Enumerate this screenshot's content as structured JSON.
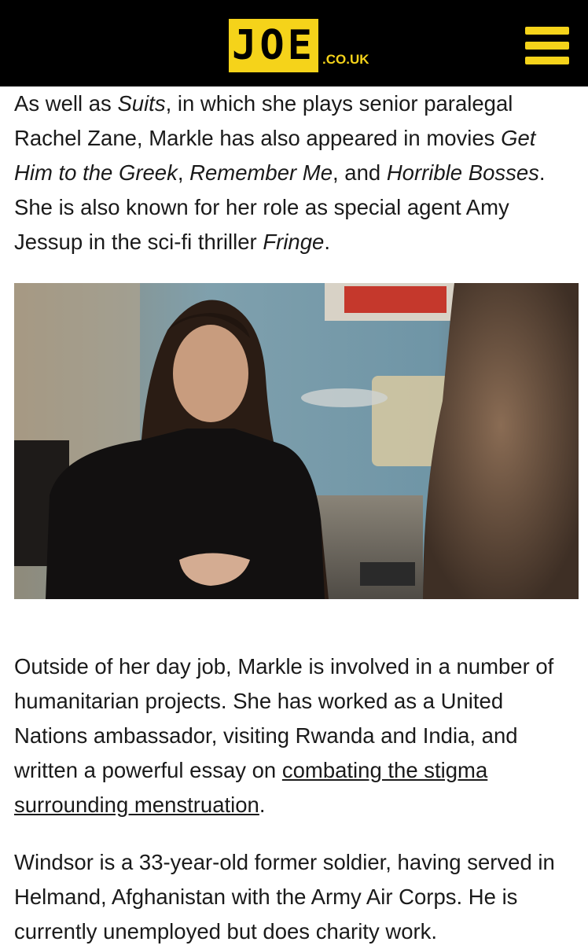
{
  "header": {
    "logo": "JOE",
    "logo_tld": ".CO.UK",
    "menu_icon": "hamburger-menu-icon",
    "colors": {
      "background": "#000000",
      "accent": "#f5d31a"
    }
  },
  "article": {
    "para1": {
      "t1": "As well as ",
      "i1": "Suits",
      "t2": ", in which she plays senior paralegal Rachel Zane, Markle has also appeared in movies ",
      "i2": "Get Him to the Greek",
      "t3": ", ",
      "i3": "Remember Me",
      "t4": ", and ",
      "i4": "Horrible Bosses",
      "t5": ". She is also known for her role as special agent Amy Jessup in the sci-fi thriller ",
      "i5": "Fringe",
      "t6": "."
    },
    "photo": {
      "subject": "woman with long dark hair in black blouse sitting at an office table, hands clasped"
    },
    "para2": {
      "t1": "Outside of her day job, Markle is involved in a number of humanitarian projects. She has worked as a United Nations ambassador, visiting Rwanda and India, and written a powerful essay on ",
      "link": "combating the stigma surrounding menstruation",
      "t2": "."
    },
    "para3": {
      "text": "Windsor is a 33-year-old former soldier, having served in Helmand, Afghanistan with the Army Air Corps. He is currently unemployed but does charity work."
    }
  }
}
